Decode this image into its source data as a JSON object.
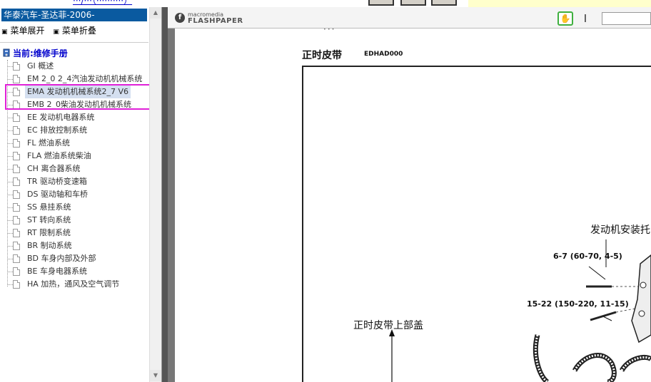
{
  "top": {
    "link_text": "···/···（··········）"
  },
  "sidebar": {
    "title": "华泰汽车-圣达菲-2006-",
    "expand_label": "菜单展开",
    "collapse_label": "菜单折叠",
    "root_label": "当前:维修手册",
    "items": [
      {
        "label": "GI 概述"
      },
      {
        "label": "EM 2_0 2_4汽油发动机机械系统"
      },
      {
        "label": "EMA 发动机机械系统2_7 V6",
        "selected": true
      },
      {
        "label": "EMB 2_0柴油发动机机械系统"
      },
      {
        "label": "EE 发动机电器系统"
      },
      {
        "label": "EC 排放控制系统"
      },
      {
        "label": "FL 燃油系统"
      },
      {
        "label": "FLA 燃油系统柴油"
      },
      {
        "label": "CH 离合器系统"
      },
      {
        "label": "TR 驱动桥变速箱"
      },
      {
        "label": "DS 驱动轴和车桥"
      },
      {
        "label": "SS 悬挂系统"
      },
      {
        "label": "ST 转向系统"
      },
      {
        "label": "RT 限制系统"
      },
      {
        "label": "BR 制动系统"
      },
      {
        "label": "BD 车身内部及外部"
      },
      {
        "label": "BE 车身电器系统"
      },
      {
        "label": "HA 加热，通风及空气调节"
      }
    ]
  },
  "viewer": {
    "brand_small": "macromedia",
    "brand_large": "FLASHPAPER",
    "page_mark": "···",
    "heading": "正时皮带",
    "code": "EDHAD000",
    "labels": {
      "engine_mount": "发动机安装托",
      "torque1": "6-7 (60-70, 4-5)",
      "torque2": "15-22 (150-220, 11-15)",
      "upper_cover": "正时皮带上部盖"
    }
  },
  "colors": {
    "title_bg": "#0a5aa0",
    "selection_box": "#e020d8",
    "hand_border": "#3fb03f"
  }
}
